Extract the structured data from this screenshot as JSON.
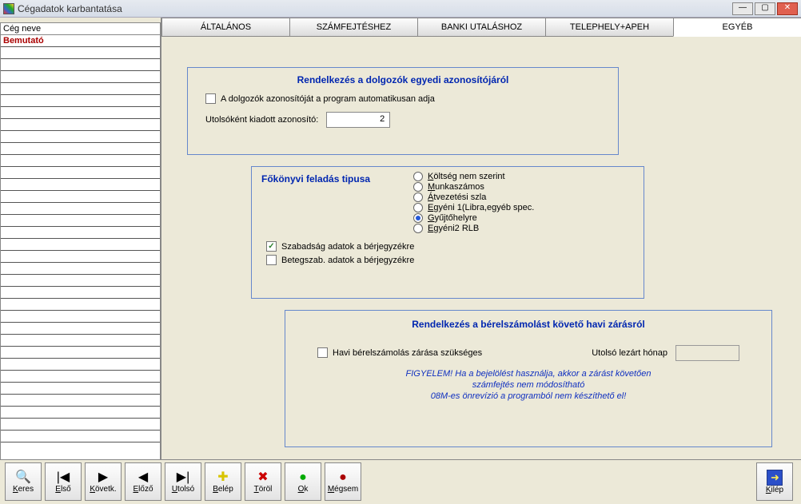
{
  "title": "Cégadatok karbantatása",
  "sidebar": {
    "header": "Cég neve",
    "items": [
      "Bemutató"
    ]
  },
  "tabs": [
    {
      "label": "ÁLTALÁNOS"
    },
    {
      "label": "SZÁMFEJTÉSHEZ"
    },
    {
      "label": "BANKI UTALÁSHOZ"
    },
    {
      "label": "TELEPHELY+APEH"
    },
    {
      "label": "EGYÉB"
    }
  ],
  "panel1": {
    "title": "Rendelkezés a dolgozók egyedi azonosítójáról",
    "chk_label": "A dolgozók azonosítóját a program automatikusan adja",
    "field_label": "Utolsóként kiadott azonosító:",
    "field_value": "2"
  },
  "panel2": {
    "title": "Főkönyvi feladás tipusa",
    "radios": [
      {
        "key": "K",
        "label": "öltség nem szerint"
      },
      {
        "key": "M",
        "label": "unkaszámos"
      },
      {
        "key": "Á",
        "label": "tvezetési szla"
      },
      {
        "key": "E",
        "label": "gyéni 1(Libra,egyéb spec."
      },
      {
        "key": "G",
        "label": "yűjtőhelyre"
      },
      {
        "key": "E",
        "label": "gyéni2 RLB"
      }
    ],
    "selected_index": 4,
    "chk1_label": "Szabadság adatok a bérjegyzékre",
    "chk1_checked": true,
    "chk2_label": "Betegszab. adatok a bérjegyzékre",
    "chk2_checked": false
  },
  "panel3": {
    "title": "Rendelkezés a bérelszámolást követő havi zárásról",
    "chk_label": "Havi bérelszámolás zárása szükséges",
    "last_closed_label": "Utolsó lezárt hónap",
    "warn1": "FIGYELEM! Ha a bejelölést használja, akkor a zárást követően",
    "warn2": "számfejtés nem módosítható",
    "warn3": "08M-es önrevízió a programból nem készíthető el!"
  },
  "toolbar": {
    "keres": {
      "icon": "🔍",
      "ukey": "K",
      "rest": "eres"
    },
    "elso": {
      "icon": "|◀",
      "ukey": "E",
      "rest": "lső"
    },
    "kovetk": {
      "icon": "▶",
      "ukey": "K",
      "rest": "övetk."
    },
    "elozo": {
      "icon": "◀",
      "ukey": "E",
      "rest": "lőző"
    },
    "utolso": {
      "icon": "▶|",
      "ukey": "U",
      "rest": "tolsó"
    },
    "belep": {
      "icon": "✚",
      "ukey": "B",
      "rest": "elép"
    },
    "torol": {
      "icon": "✖",
      "ukey": "T",
      "rest": "öröl"
    },
    "ok": {
      "icon": "●",
      "ukey": "O",
      "rest": "k"
    },
    "megsem": {
      "icon": "●",
      "ukey": "M",
      "rest": "égsem"
    },
    "kilep": {
      "ukey": "K",
      "rest": "ilép"
    }
  }
}
